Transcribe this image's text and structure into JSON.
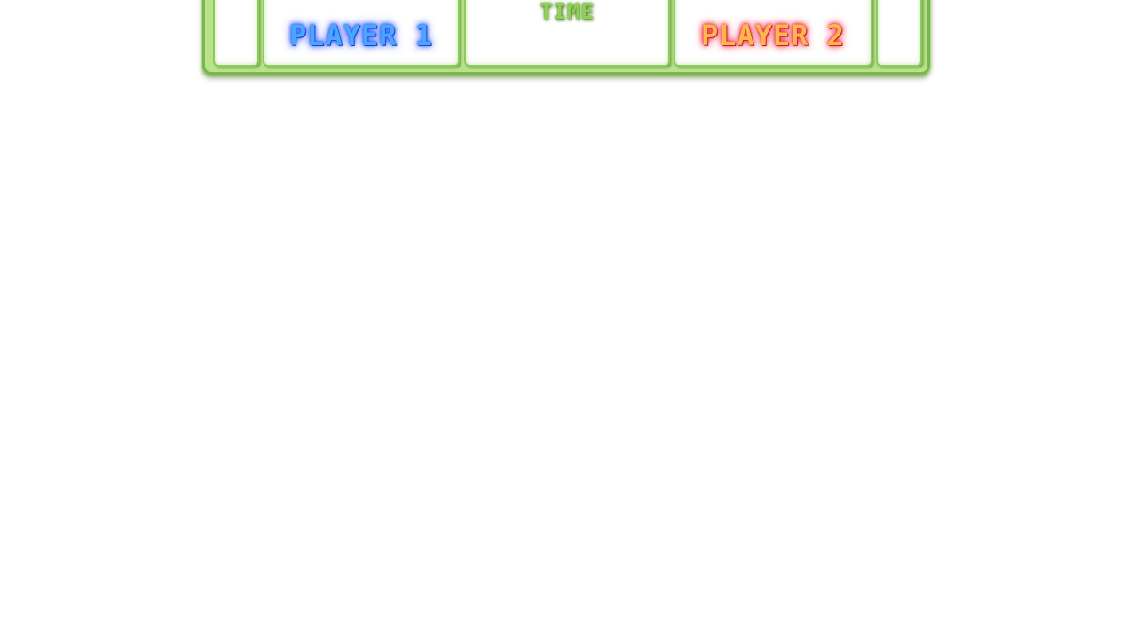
{
  "scoreboard": {
    "player1_label": "PLAYER 1",
    "time_label": "TIME",
    "player2_label": "PLAYER 2"
  },
  "colors": {
    "frame": "#b9e38a",
    "frame_border": "#78b84a",
    "player1": "#4aa6ff",
    "player2": "#ffb84a",
    "time": "#8ed05a",
    "background": "#ffffff"
  }
}
